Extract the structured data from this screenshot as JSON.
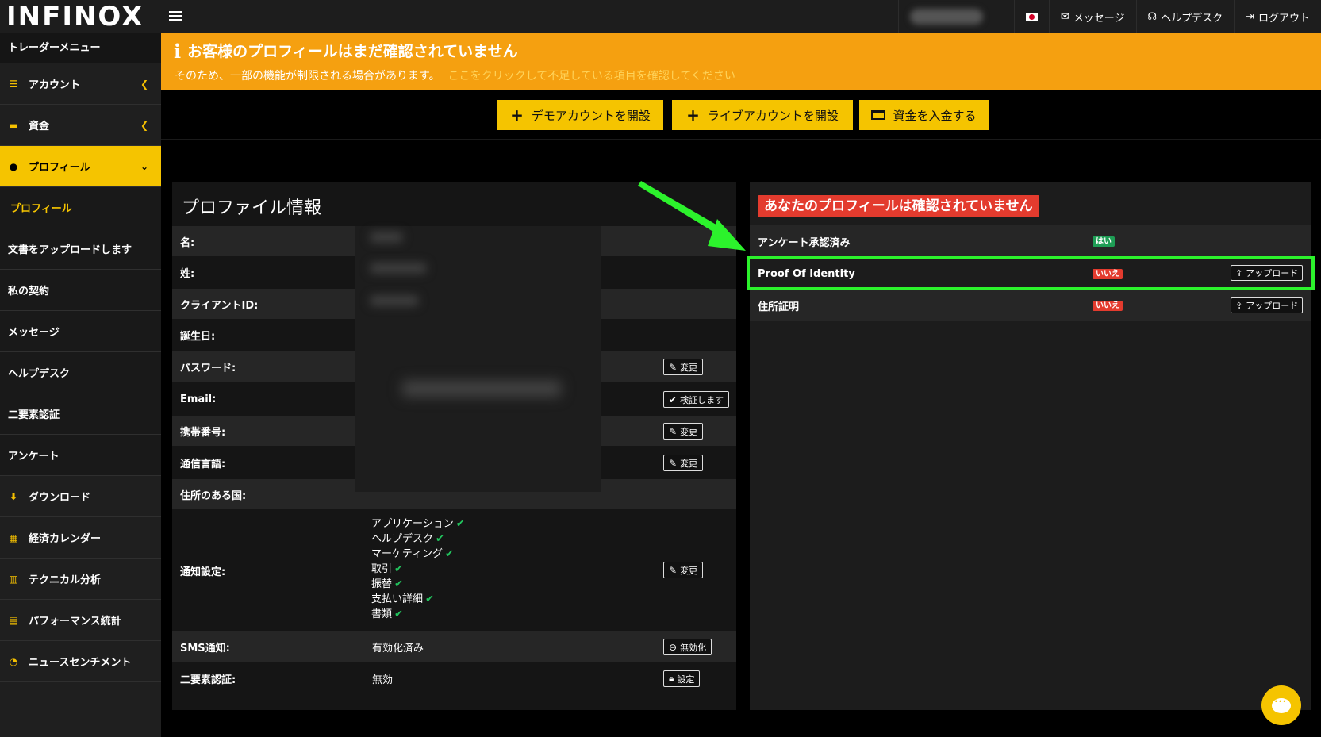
{
  "brand": {
    "logo_text": "INFINOX",
    "accent_color": "#f5c400",
    "banner_color": "#f5a010"
  },
  "topbar": {
    "flag": "jp-flag",
    "messages_label": "メッセージ",
    "helpdesk_label": "ヘルプデスク",
    "logout_label": "ログアウト"
  },
  "sidebar": {
    "header": "トレーダーメニュー",
    "items": [
      {
        "label": "アカウント",
        "icon": "list-icon",
        "expand": "chevron-left-icon"
      },
      {
        "label": "資金",
        "icon": "wallet-icon",
        "expand": "chevron-left-icon"
      },
      {
        "label": "プロフィール",
        "icon": "user-icon",
        "expand": "chevron-down-icon",
        "active": true
      },
      {
        "label": "プロフィール",
        "sub": true,
        "current": true
      },
      {
        "label": "文書をアップロードします",
        "sub": true
      },
      {
        "label": "私の契約",
        "sub": true
      },
      {
        "label": "メッセージ",
        "sub": true
      },
      {
        "label": "ヘルプデスク",
        "sub": true
      },
      {
        "label": "二要素認証",
        "sub": true
      },
      {
        "label": "アンケート",
        "sub": true
      },
      {
        "label": "ダウンロード",
        "icon": "download-icon"
      },
      {
        "label": "経済カレンダー",
        "icon": "calendar-icon"
      },
      {
        "label": "テクニカル分析",
        "icon": "bar-chart-icon"
      },
      {
        "label": "パフォーマンス統計",
        "icon": "stats-icon"
      },
      {
        "label": "ニュースセンチメント",
        "icon": "gauge-icon"
      }
    ]
  },
  "banner": {
    "title": "お客様のプロフィールはまだ確認されていません",
    "text": "そのため、一部の機能が制限される場合があります。",
    "link": "ここをクリックして不足している項目を確認してください"
  },
  "actions": {
    "demo": "デモアカウントを開設",
    "live": "ライブアカウントを開設",
    "deposit": "資金を入金する"
  },
  "profile": {
    "title": "プロファイル情報",
    "rows": {
      "first_name": "名:",
      "last_name": "姓:",
      "client_id": "クライアントID:",
      "birthday": "誕生日:",
      "password": "パスワード:",
      "email": "Email:",
      "mobile": "携帯番号:",
      "language": "通信言語:",
      "country": "住所のある国:",
      "notifications": "通知設定:",
      "sms": "SMS通知:",
      "twofa": "二要素認証:"
    },
    "buttons": {
      "change": "変更",
      "verify": "検証します",
      "disable": "無効化",
      "setup": "設定"
    },
    "notifications": [
      "アプリケーション",
      "ヘルプデスク",
      "マーケティング",
      "取引",
      "振替",
      "支払い詳細",
      "書類"
    ],
    "sms_value": "有効化済み",
    "twofa_value": "無効"
  },
  "verification": {
    "title": "あなたのプロフィールは確認されていません",
    "rows": [
      {
        "label": "アンケート承認済み",
        "status": "はい"
      },
      {
        "label": "Proof Of Identity",
        "status": "いいえ",
        "action": "アップロード"
      },
      {
        "label": "住所証明",
        "status": "いいえ",
        "action": "アップロード"
      }
    ],
    "highlight_color": "#2cf22c"
  }
}
